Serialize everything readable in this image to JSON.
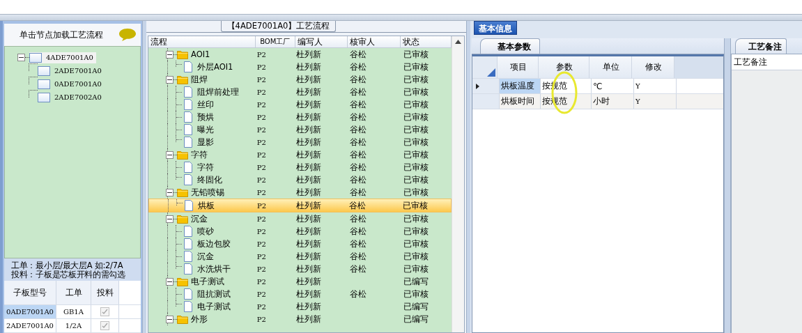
{
  "left_panel": {
    "header": "单击节点加载工艺流程",
    "tree": {
      "label": "4ADE7001A0",
      "expanded": true,
      "children": [
        {
          "label": "2ADE7001A0"
        },
        {
          "label": "0ADE7001A0"
        },
        {
          "label": "2ADE7002A0"
        }
      ]
    },
    "note_lines": [
      "工单：最小层/最大层A 如:2/7A",
      "投料：子板是芯板开料的需勾选"
    ],
    "table": {
      "columns": [
        "子板型号",
        "工单",
        "投料"
      ],
      "rows": [
        {
          "board": "0ADE7001A0",
          "order": "GB1A",
          "checked": true,
          "selected": true
        },
        {
          "board": "2ADE7001A0",
          "order": "1/2A",
          "checked": true,
          "selected": false
        }
      ]
    }
  },
  "process_panel": {
    "title": "【4ADE7001A0】工艺流程",
    "columns": [
      "流程",
      "BOM工厂",
      "编写人",
      "核审人",
      "状态"
    ],
    "groups": [
      {
        "name": "AOI1",
        "expanded": true,
        "factory": "P2",
        "author": "杜列新",
        "reviewer": "谷松",
        "status": "已审核",
        "selected": false,
        "children": [
          {
            "name": "外层AOI1",
            "factory": "P2",
            "author": "杜列新",
            "reviewer": "谷松",
            "status": "已审核",
            "selected": false
          }
        ]
      },
      {
        "name": "阻焊",
        "expanded": true,
        "factory": "P2",
        "author": "杜列新",
        "reviewer": "谷松",
        "status": "已审核",
        "selected": false,
        "children": [
          {
            "name": "阻焊前处理",
            "factory": "P2",
            "author": "杜列新",
            "reviewer": "谷松",
            "status": "已审核",
            "selected": false
          },
          {
            "name": "丝印",
            "factory": "P2",
            "author": "杜列新",
            "reviewer": "谷松",
            "status": "已审核",
            "selected": false
          },
          {
            "name": "预烘",
            "factory": "P2",
            "author": "杜列新",
            "reviewer": "谷松",
            "status": "已审核",
            "selected": false
          },
          {
            "name": "曝光",
            "factory": "P2",
            "author": "杜列新",
            "reviewer": "谷松",
            "status": "已审核",
            "selected": false
          },
          {
            "name": "显影",
            "factory": "P2",
            "author": "杜列新",
            "reviewer": "谷松",
            "status": "已审核",
            "selected": false
          }
        ]
      },
      {
        "name": "字符",
        "expanded": true,
        "factory": "P2",
        "author": "杜列新",
        "reviewer": "谷松",
        "status": "已审核",
        "selected": false,
        "children": [
          {
            "name": "字符",
            "factory": "P2",
            "author": "杜列新",
            "reviewer": "谷松",
            "status": "已审核",
            "selected": false
          },
          {
            "name": "终固化",
            "factory": "P2",
            "author": "杜列新",
            "reviewer": "谷松",
            "status": "已审核",
            "selected": false
          }
        ]
      },
      {
        "name": "无铅喷锡",
        "expanded": true,
        "factory": "P2",
        "author": "杜列新",
        "reviewer": "谷松",
        "status": "已审核",
        "selected": false,
        "children": [
          {
            "name": "烘板",
            "factory": "P2",
            "author": "杜列新",
            "reviewer": "谷松",
            "status": "已审核",
            "selected": true
          }
        ]
      },
      {
        "name": "沉金",
        "expanded": true,
        "factory": "P2",
        "author": "杜列新",
        "reviewer": "谷松",
        "status": "已审核",
        "selected": false,
        "children": [
          {
            "name": "喷砂",
            "factory": "P2",
            "author": "杜列新",
            "reviewer": "谷松",
            "status": "已审核",
            "selected": false
          },
          {
            "name": "板边包胶",
            "factory": "P2",
            "author": "杜列新",
            "reviewer": "谷松",
            "status": "已审核",
            "selected": false
          },
          {
            "name": "沉金",
            "factory": "P2",
            "author": "杜列新",
            "reviewer": "谷松",
            "status": "已审核",
            "selected": false
          },
          {
            "name": "水洗烘干",
            "factory": "P2",
            "author": "杜列新",
            "reviewer": "谷松",
            "status": "已审核",
            "selected": false
          }
        ]
      },
      {
        "name": "电子测试",
        "expanded": true,
        "factory": "P2",
        "author": "杜列新",
        "status": "已编写",
        "selected": false,
        "children": [
          {
            "name": "阻抗测试",
            "factory": "P2",
            "author": "杜列新",
            "reviewer": "谷松",
            "status": "已审核",
            "selected": false
          },
          {
            "name": "电子测试",
            "factory": "P2",
            "author": "杜列新",
            "status": "已编写",
            "selected": false
          }
        ]
      },
      {
        "name": "外形",
        "expanded": true,
        "factory": "P2",
        "author": "杜列新",
        "status": "已编写",
        "selected": false
      }
    ]
  },
  "info_panel": {
    "tabs": [
      {
        "label": "基本信息",
        "selected": true
      }
    ],
    "params": {
      "tab": "基本参数",
      "columns": [
        "项目",
        "参数",
        "单位",
        "修改"
      ],
      "rows": [
        {
          "cells": [
            "烘板温度",
            "按规范",
            "℃",
            "Y"
          ],
          "current": true
        },
        {
          "cells": [
            "烘板时间",
            "按规范",
            "小时",
            "Y"
          ],
          "current": false
        }
      ]
    },
    "notes": {
      "tab": "工艺备注",
      "label": "工艺备注"
    }
  }
}
